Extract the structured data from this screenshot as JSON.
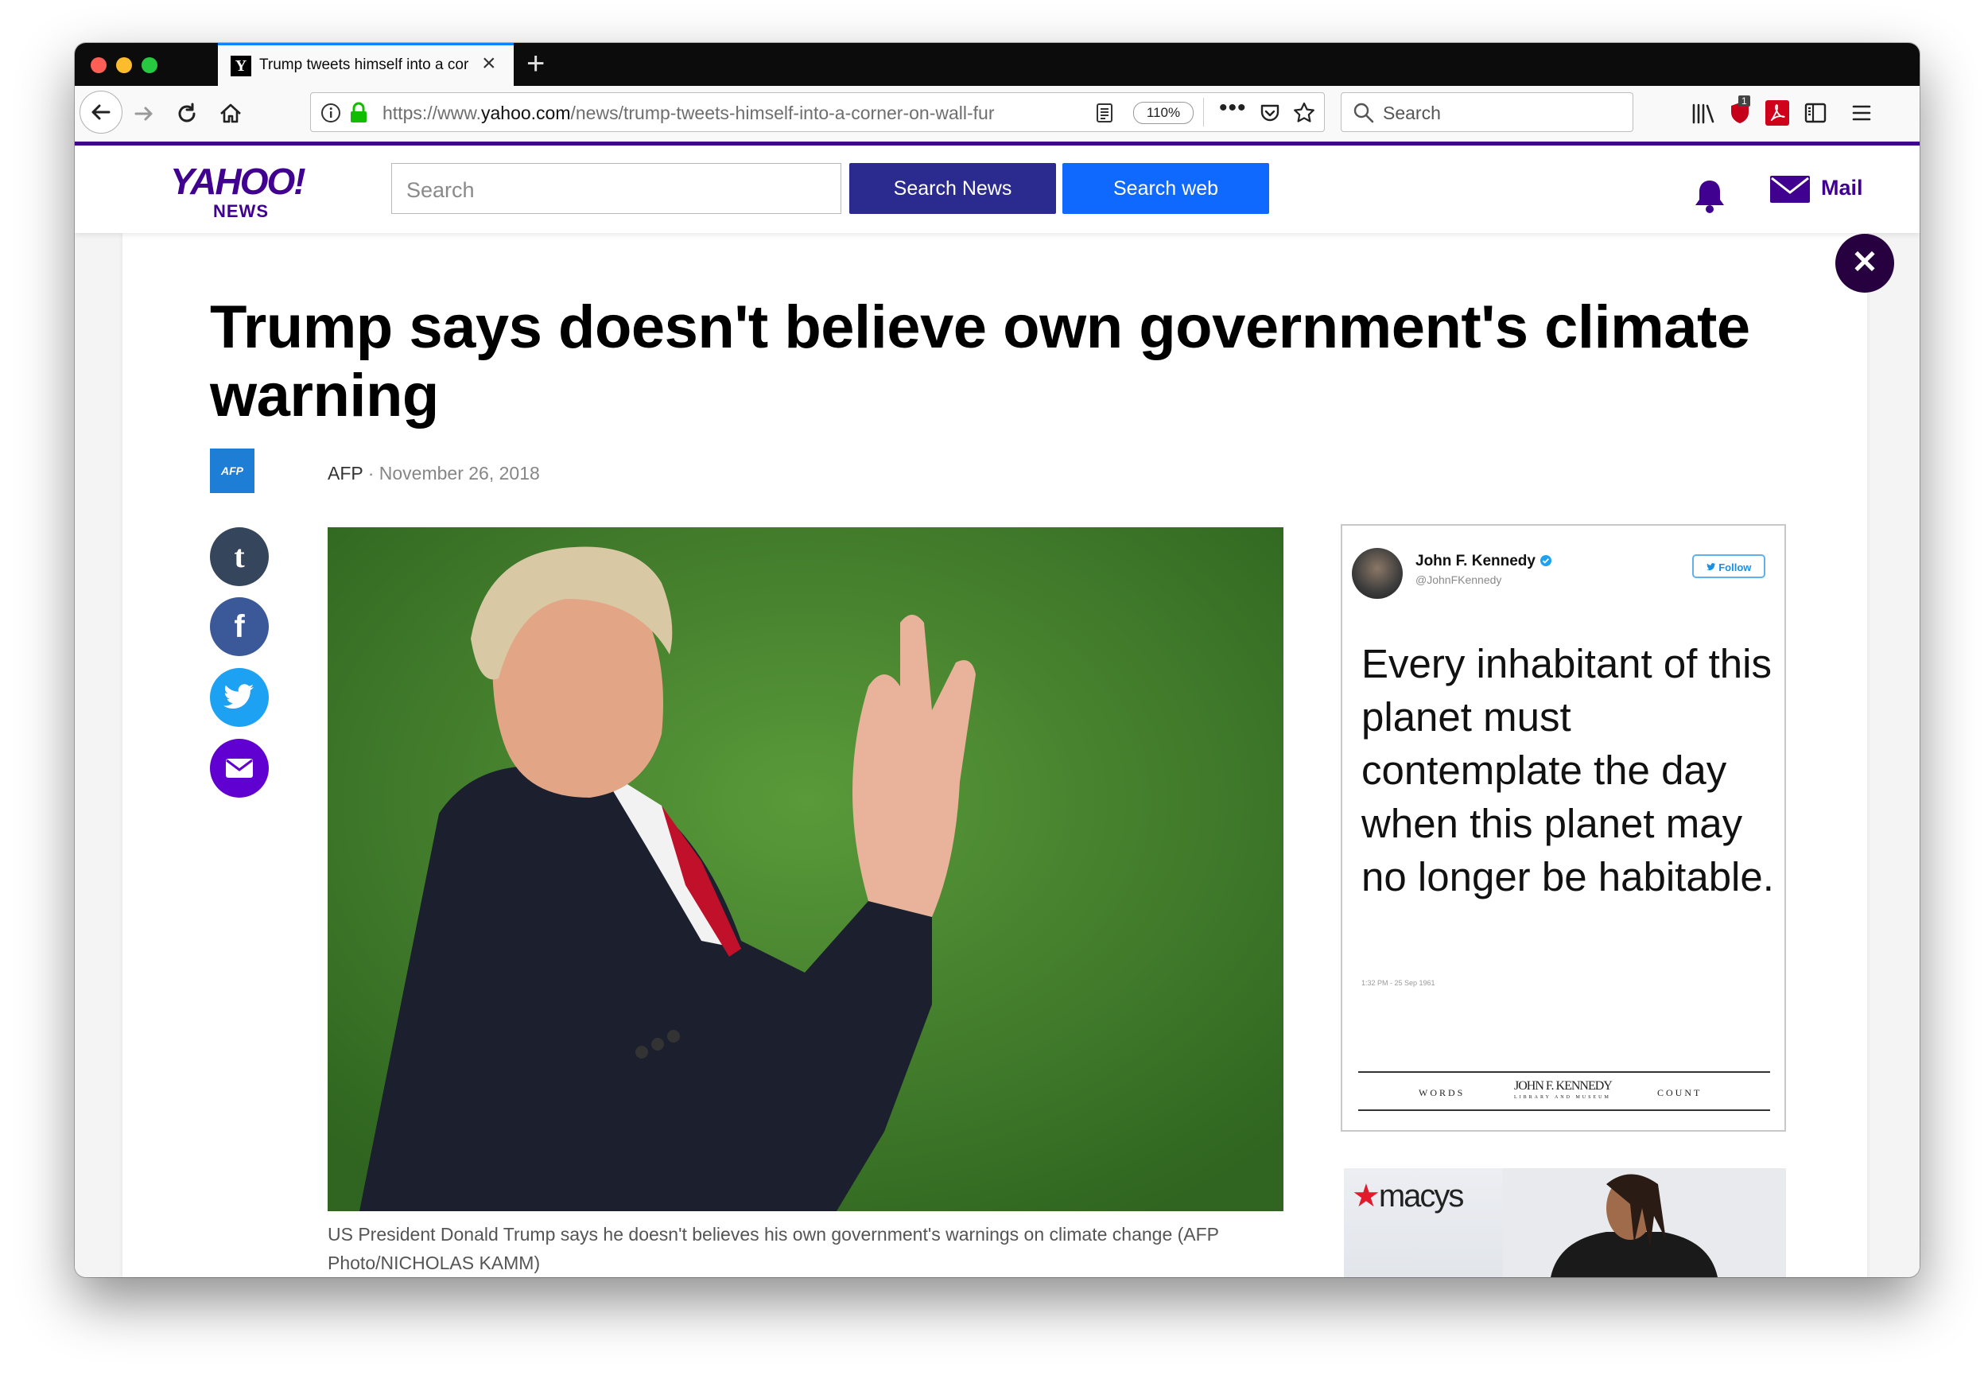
{
  "browser": {
    "tab_title": "Trump tweets himself into a cor",
    "url_prefix": "https://www.",
    "url_domain": "yahoo.com",
    "url_path": "/news/trump-tweets-himself-into-a-corner-on-wall-fur",
    "zoom": "110%",
    "search_placeholder": "Search",
    "notification_count": "1",
    "colors": {
      "tab_active_accent": "#0a84ff",
      "toolbar_bg": "#f9f9fa",
      "tabstrip_bg": "#0c0c0d"
    }
  },
  "yahoo": {
    "logo": "YAHOO!",
    "logo_sub": "NEWS",
    "search_placeholder": "Search",
    "search_news_label": "Search News",
    "search_web_label": "Search web",
    "mail_label": "Mail",
    "colors": {
      "brand_purple": "#400090",
      "news_button": "#2a2a8f",
      "web_button": "#0f69ff"
    }
  },
  "article": {
    "headline": "Trump says doesn't believe own government's climate warning",
    "source_logo": "AFP",
    "source": "AFP",
    "separator": "·",
    "date": "November 26, 2018",
    "caption": "US President Donald Trump says he doesn't believes his own government's warnings on climate change (AFP Photo/NICHOLAS KAMM)",
    "social": [
      {
        "name": "tumblr",
        "glyph": "t",
        "color": "#35465c"
      },
      {
        "name": "facebook",
        "glyph": "f",
        "color": "#3b5998"
      },
      {
        "name": "twitter",
        "glyph": "bird",
        "color": "#1da1f2"
      },
      {
        "name": "email",
        "glyph": "envelope",
        "color": "#6001d2"
      }
    ]
  },
  "tweet": {
    "name": "John F. Kennedy",
    "handle": "@JohnFKennedy",
    "follow_label": "Follow",
    "quote": "Every inhabitant of this planet must contemplate the day when this planet may no longer be habitable.",
    "timestamp": "1:32 PM - 25 Sep 1961",
    "footer_left": "WORDS",
    "footer_logo": "JOHN F. KENNEDY",
    "footer_logo_sub": "LIBRARY AND MUSEUM",
    "footer_right": "COUNT"
  },
  "ad": {
    "brand": "macys"
  }
}
